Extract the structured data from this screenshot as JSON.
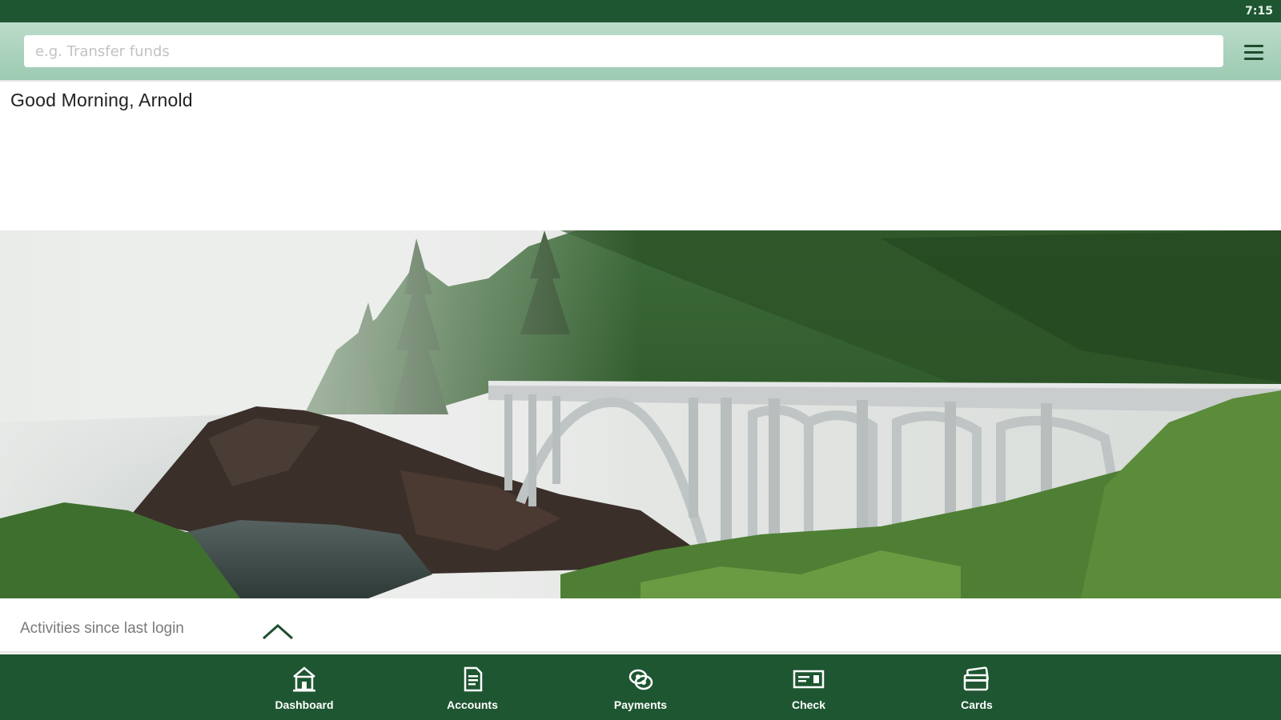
{
  "status_bar": {
    "time": "7:15"
  },
  "search": {
    "placeholder": "e.g. Transfer funds",
    "value": ""
  },
  "header": {
    "menu_icon": "hamburger-menu-icon"
  },
  "greeting": {
    "text": "Good Morning, Arnold"
  },
  "hero": {
    "subject": "coastal-bridge-photo"
  },
  "activities": {
    "label": "Activities since last login",
    "toggle_icon": "chevron-up-icon"
  },
  "bottom_nav": {
    "items": [
      {
        "label": "Dashboard",
        "icon": "home-icon"
      },
      {
        "label": "Accounts",
        "icon": "document-icon"
      },
      {
        "label": "Payments",
        "icon": "payments-icon"
      },
      {
        "label": "Check",
        "icon": "check-icon"
      },
      {
        "label": "Cards",
        "icon": "cards-icon"
      }
    ]
  },
  "colors": {
    "primary": "#1e5631",
    "header_tint": "#a9d1bb",
    "text_dark": "#222222",
    "text_muted": "#7a7a7a"
  }
}
